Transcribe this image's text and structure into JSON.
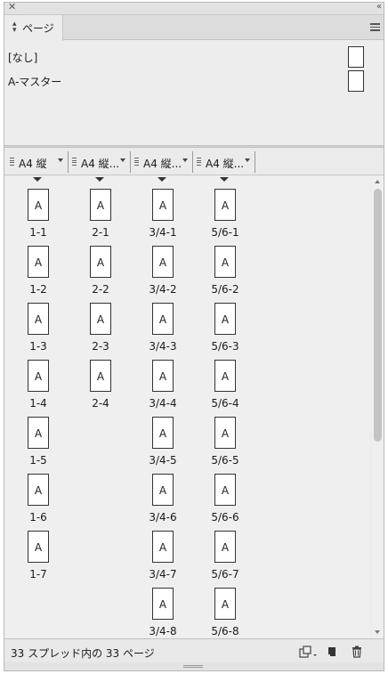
{
  "panel": {
    "tab_label": "ページ",
    "icons": {
      "close": "close-icon",
      "collapse": "collapse-icon",
      "menu": "panel-menu-icon",
      "sort": "up-down-icon"
    }
  },
  "masters": [
    {
      "label": "[なし]"
    },
    {
      "label": "A-マスター"
    }
  ],
  "columns": [
    {
      "label": "A4 縦"
    },
    {
      "label": "A4 縦..."
    },
    {
      "label": "A4 縦..."
    },
    {
      "label": "A4 縦..."
    }
  ],
  "page_columns": [
    {
      "pages": [
        {
          "prefix": "A",
          "label": "1-1"
        },
        {
          "prefix": "A",
          "label": "1-2"
        },
        {
          "prefix": "A",
          "label": "1-3"
        },
        {
          "prefix": "A",
          "label": "1-4"
        },
        {
          "prefix": "A",
          "label": "1-5"
        },
        {
          "prefix": "A",
          "label": "1-6"
        },
        {
          "prefix": "A",
          "label": "1-7"
        }
      ]
    },
    {
      "pages": [
        {
          "prefix": "A",
          "label": "2-1"
        },
        {
          "prefix": "A",
          "label": "2-2"
        },
        {
          "prefix": "A",
          "label": "2-3"
        },
        {
          "prefix": "A",
          "label": "2-4"
        }
      ]
    },
    {
      "pages": [
        {
          "prefix": "A",
          "label": "3/4-1"
        },
        {
          "prefix": "A",
          "label": "3/4-2"
        },
        {
          "prefix": "A",
          "label": "3/4-3"
        },
        {
          "prefix": "A",
          "label": "3/4-4"
        },
        {
          "prefix": "A",
          "label": "3/4-5"
        },
        {
          "prefix": "A",
          "label": "3/4-6"
        },
        {
          "prefix": "A",
          "label": "3/4-7"
        },
        {
          "prefix": "A",
          "label": "3/4-8"
        }
      ]
    },
    {
      "pages": [
        {
          "prefix": "A",
          "label": "5/6-1"
        },
        {
          "prefix": "A",
          "label": "5/6-2"
        },
        {
          "prefix": "A",
          "label": "5/6-3"
        },
        {
          "prefix": "A",
          "label": "5/6-4"
        },
        {
          "prefix": "A",
          "label": "5/6-5"
        },
        {
          "prefix": "A",
          "label": "5/6-6"
        },
        {
          "prefix": "A",
          "label": "5/6-7"
        },
        {
          "prefix": "A",
          "label": "5/6-8"
        }
      ]
    }
  ],
  "status": {
    "text": "33 スプレッド内の 33 ページ",
    "buttons": [
      "edit-page-size-icon",
      "new-page-icon",
      "trash-icon"
    ]
  }
}
